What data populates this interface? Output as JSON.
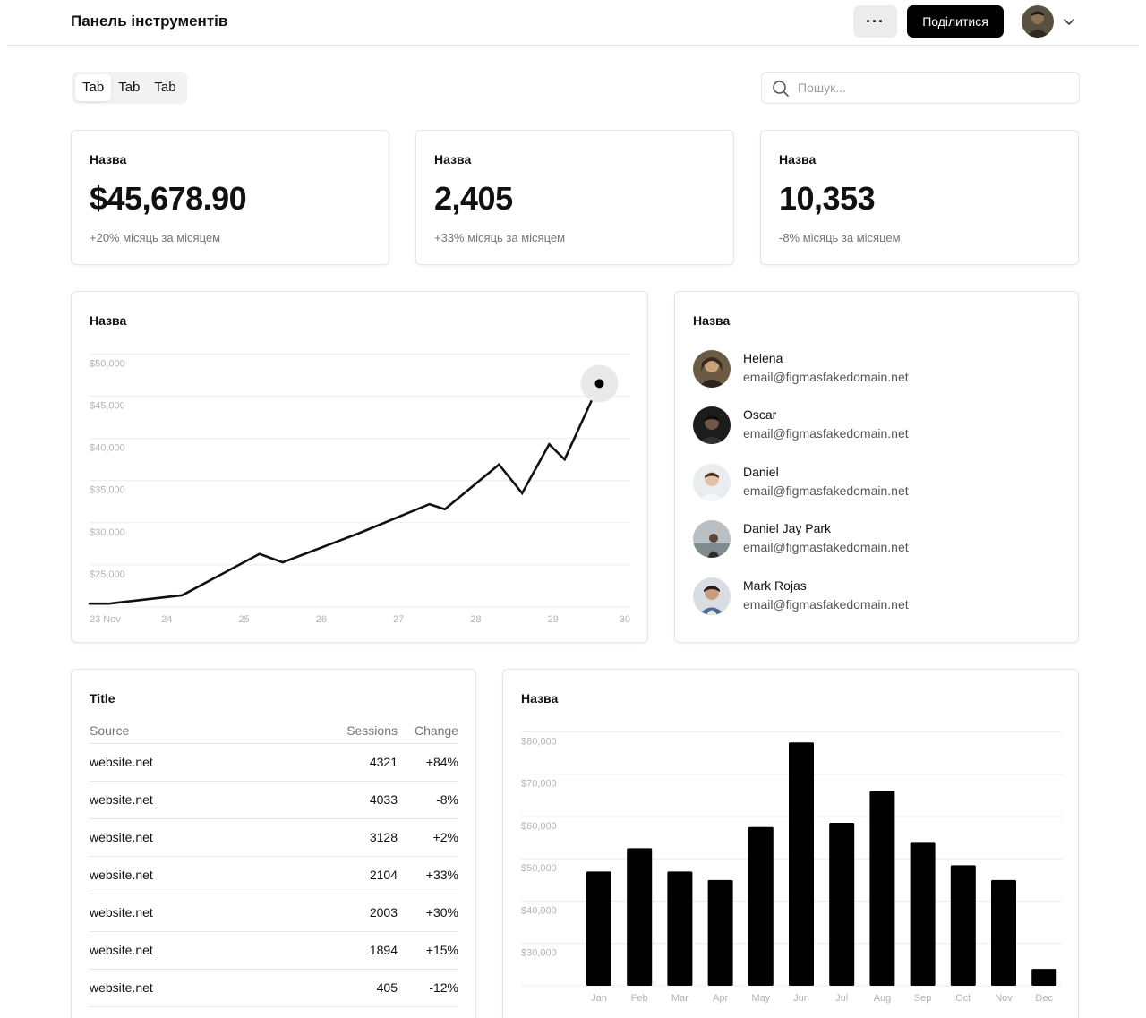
{
  "header": {
    "title": "Панель інструментів",
    "more_label": "···",
    "share_label": "Поділитися"
  },
  "tabs": [
    {
      "label": "Tab"
    },
    {
      "label": "Tab"
    },
    {
      "label": "Tab"
    }
  ],
  "search": {
    "value": "",
    "placeholder": "Пошук..."
  },
  "stats": [
    {
      "title": "Назва",
      "value": "$45,678.90",
      "change": "+20% місяць за місяцем"
    },
    {
      "title": "Назва",
      "value": "2,405",
      "change": "+33% місяць за місяцем"
    },
    {
      "title": "Назва",
      "value": "10,353",
      "change": "-8% місяць за місяцем"
    }
  ],
  "line_card": {
    "title": "Назва"
  },
  "users_card": {
    "title": "Назва",
    "users": [
      {
        "name": "Helena",
        "email": "email@figmasfakedomain.net"
      },
      {
        "name": "Oscar",
        "email": "email@figmasfakedomain.net"
      },
      {
        "name": "Daniel",
        "email": "email@figmasfakedomain.net"
      },
      {
        "name": "Daniel Jay Park",
        "email": "email@figmasfakedomain.net"
      },
      {
        "name": "Mark Rojas",
        "email": "email@figmasfakedomain.net"
      }
    ]
  },
  "table_card": {
    "title": "Title",
    "columns": [
      "Source",
      "Sessions",
      "Change"
    ],
    "rows": [
      {
        "source": "website.net",
        "sessions": "4321",
        "change": "+84%"
      },
      {
        "source": "website.net",
        "sessions": "4033",
        "change": "-8%"
      },
      {
        "source": "website.net",
        "sessions": "3128",
        "change": "+2%"
      },
      {
        "source": "website.net",
        "sessions": "2104",
        "change": "+33%"
      },
      {
        "source": "website.net",
        "sessions": "2003",
        "change": "+30%"
      },
      {
        "source": "website.net",
        "sessions": "1894",
        "change": "+15%"
      },
      {
        "source": "website.net",
        "sessions": "405",
        "change": "-12%"
      }
    ]
  },
  "bar_card": {
    "title": "Назва"
  },
  "chart_data": [
    {
      "type": "line",
      "title": "Назва",
      "x_tick_labels": [
        "23 Nov",
        "24",
        "25",
        "26",
        "27",
        "28",
        "29",
        "30"
      ],
      "y_tick_labels": [
        "$50,000",
        "$45,000",
        "$40,000",
        "$35,000",
        "$30,000",
        "$25,000"
      ],
      "ylim": [
        20000,
        51000
      ],
      "xlim": [
        23,
        30
      ],
      "grid": true,
      "series": [
        {
          "x": [
            23.0,
            23.25,
            24.2,
            25.2,
            25.5,
            26.5,
            27.4,
            27.6,
            28.3,
            28.6,
            28.95,
            29.15,
            29.6
          ],
          "y": [
            20400,
            20400,
            21400,
            26300,
            25300,
            28800,
            32200,
            31600,
            36900,
            33500,
            39300,
            37500,
            46500
          ]
        }
      ],
      "highlight_point": {
        "x": 29.6,
        "y": 46500
      }
    },
    {
      "type": "bar",
      "title": "Назва",
      "categories": [
        "Jan",
        "Feb",
        "Mar",
        "Apr",
        "May",
        "Jun",
        "Jul",
        "Aug",
        "Sep",
        "Oct",
        "Nov",
        "Dec"
      ],
      "values": [
        47000,
        52500,
        47000,
        45000,
        57500,
        77500,
        58500,
        66000,
        54000,
        48500,
        45000,
        24000
      ],
      "y_tick_labels": [
        "$80,000",
        "$70,000",
        "$60,000",
        "$50,000",
        "$40,000",
        "$30,000"
      ],
      "ylim": [
        20000,
        82000
      ],
      "grid": true,
      "color": "#000000"
    }
  ],
  "colors": {
    "accent": "#000000",
    "muted_text": "#757575",
    "border": "#e6e6e6",
    "grid": "#ececec"
  }
}
